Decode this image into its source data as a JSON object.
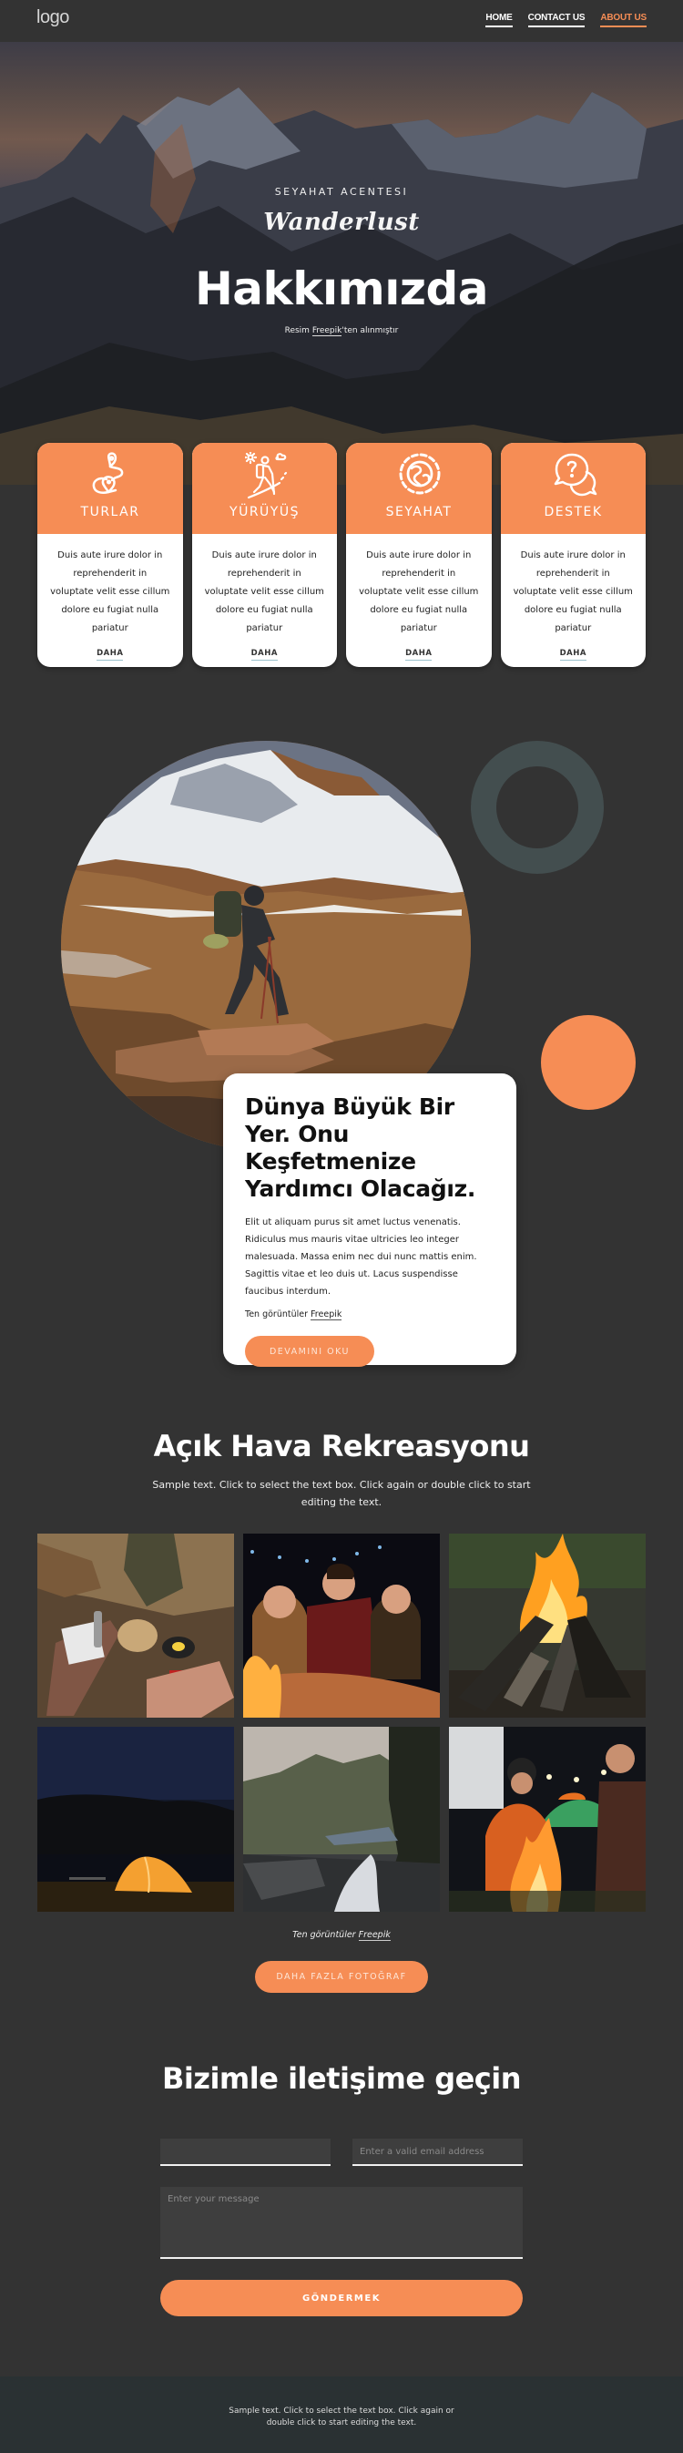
{
  "header": {
    "logo": "logo",
    "nav": [
      {
        "label": "HOME",
        "active": false
      },
      {
        "label": "CONTACT US",
        "active": false
      },
      {
        "label": "ABOUT US",
        "active": true
      }
    ]
  },
  "hero": {
    "subtitle": "SEYAHAT ACENTESI",
    "script_logo": "Wanderlust",
    "title": "Hakkımızda",
    "credit_prefix": "Resim ",
    "credit_link": "Freepik",
    "credit_suffix": "'ten alınmıştır"
  },
  "cards": [
    {
      "icon": "map-route-icon",
      "title": "TURLAR",
      "text": "Duis aute irure dolor in reprehenderit in voluptate velit esse cillum dolore eu fugiat nulla pariatur",
      "link": "DAHA"
    },
    {
      "icon": "hiker-icon",
      "title": "YÜRÜYÜŞ",
      "text": "Duis aute irure dolor in reprehenderit in voluptate velit esse cillum dolore eu fugiat nulla pariatur",
      "link": "DAHA"
    },
    {
      "icon": "globe-icon",
      "title": "SEYAHAT",
      "text": "Duis aute irure dolor in reprehenderit in voluptate velit esse cillum dolore eu fugiat nulla pariatur",
      "link": "DAHA"
    },
    {
      "icon": "help-chat-icon",
      "title": "DESTEK",
      "text": "Duis aute irure dolor in reprehenderit in voluptate velit esse cillum dolore eu fugiat nulla pariatur",
      "link": "DAHA"
    }
  ],
  "about": {
    "title": "Dünya Büyük Bir Yer. Onu Keşfetmenize Yardımcı Olacağız.",
    "text": "Elit ut aliquam purus sit amet luctus venenatis. Ridiculus mus mauris vitae ultricies leo integer malesuada. Massa enim nec dui nunc mattis enim. Sagittis vitae et leo duis ut. Lacus suspendisse faucibus interdum.",
    "credit_prefix": "Ten görüntüler ",
    "credit_link": "Freepik",
    "button": "DEVAMINI OKU"
  },
  "recreation": {
    "title": "Açık Hava Rekreasyonu",
    "subtitle": "Sample text. Click to select the text box. Click again or double click to start editing the text.",
    "photos": [
      {
        "name": "camping-picnic-photo"
      },
      {
        "name": "friends-campfire-photo"
      },
      {
        "name": "bonfire-photo"
      },
      {
        "name": "tent-night-lake-photo"
      },
      {
        "name": "mountain-river-photo"
      },
      {
        "name": "couple-campfire-photo"
      }
    ],
    "credit_prefix": "Ten görüntüler ",
    "credit_link": "Freepik",
    "button": "DAHA FAZLA FOTOĞRAF"
  },
  "contact": {
    "title": "Bizimle iletişime geçin",
    "name_placeholder": "",
    "email_placeholder": "Enter a valid email address",
    "message_placeholder": "Enter your message",
    "submit": "GÖNDERMEK"
  },
  "footer": {
    "text": "Sample text. Click to select the text box. Click again or double click to start editing the text."
  },
  "colors": {
    "accent": "#f68d55",
    "background": "#333333",
    "footer": "#2a3133",
    "ring": "#434e4f"
  }
}
